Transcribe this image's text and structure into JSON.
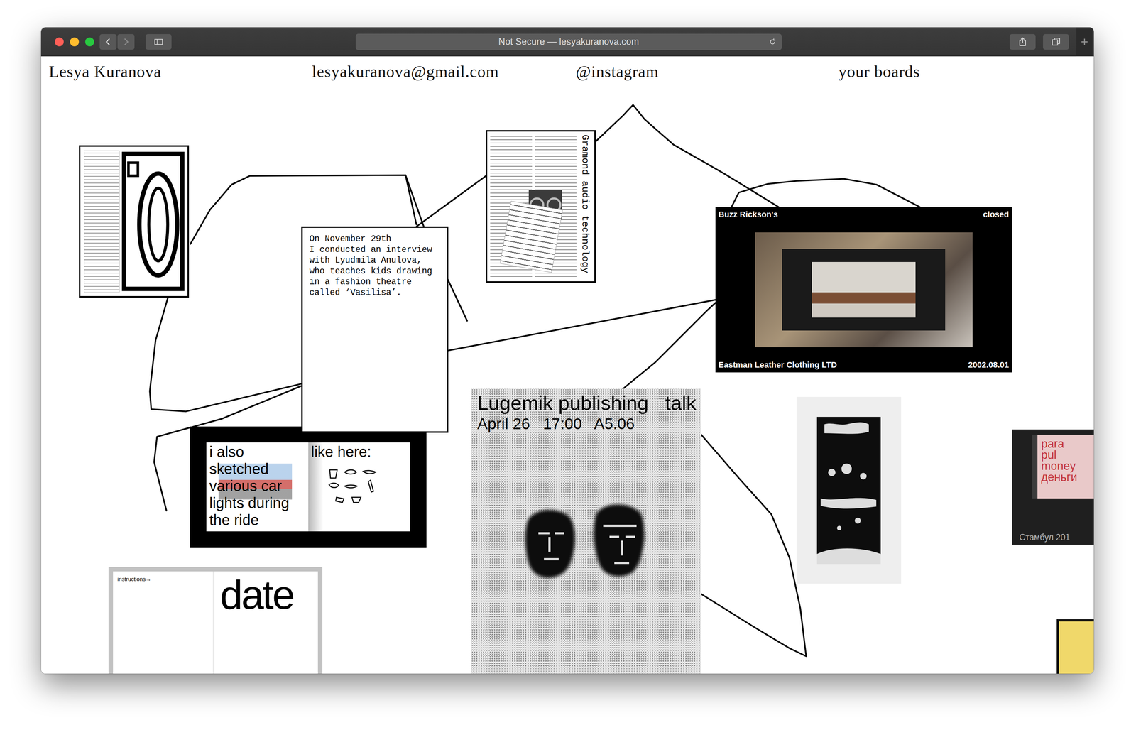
{
  "browser": {
    "address": "Not Secure — lesyakuranova.com"
  },
  "nav": [
    {
      "label": "Lesya Kuranova"
    },
    {
      "label": "lesyakuranova@gmail.com"
    },
    {
      "label": "@instagram"
    },
    {
      "label": "your boards"
    }
  ],
  "interview": {
    "lines": [
      "On November 29th",
      "I conducted an interview",
      "with Lyudmila Anulova,",
      "who teaches kids drawing",
      "in a fashion theatre",
      "called ‘Vasilisa’."
    ]
  },
  "garamond": {
    "title": "Gramond audio technology"
  },
  "buzz": {
    "top_left": "Buzz Rickson's",
    "top_right": "closed",
    "bottom_left": "Eastman Leather Clothing LTD",
    "bottom_right": "2002.08.01"
  },
  "lugemik": {
    "title": "Lugemik publishing   talk",
    "details": "April 26   17:00   A5.06"
  },
  "car_sketch": {
    "left": "i also sketched various car lights during the ride",
    "right": "like here:"
  },
  "date_card": {
    "note": "instructions→",
    "word": "date"
  },
  "para_pul": {
    "lines": [
      "para",
      "pul",
      "money",
      "деньги"
    ],
    "caption": "Стамбул 201"
  }
}
